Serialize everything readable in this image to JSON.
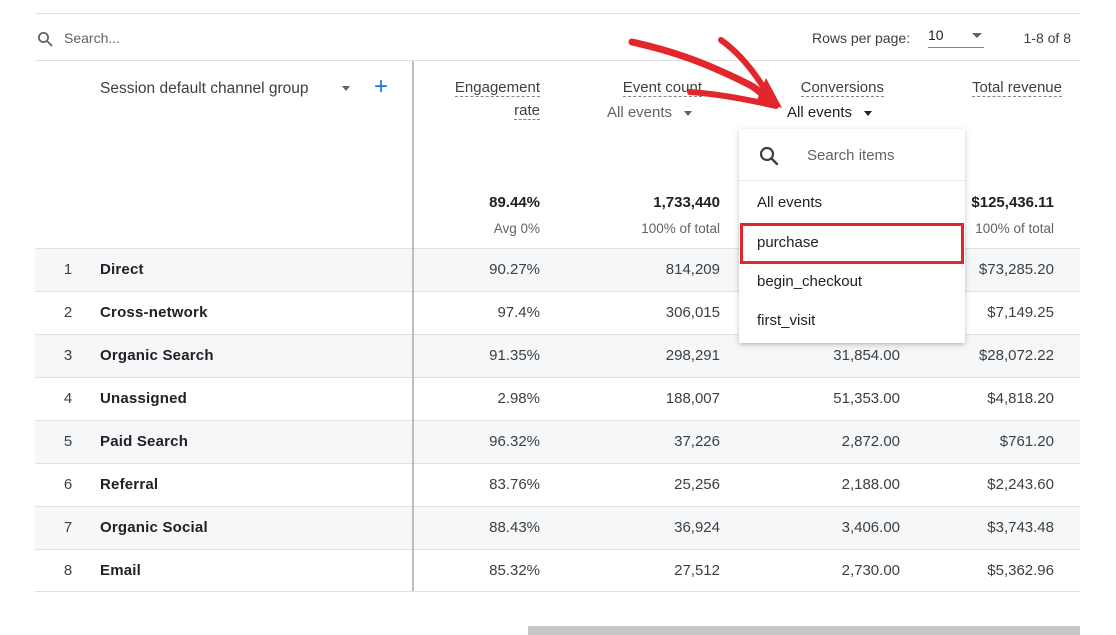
{
  "toolbar": {
    "search_placeholder": "Search...",
    "rows_per_page_label": "Rows per page:",
    "rows_per_page_value": "10",
    "pagination": "1-8 of 8"
  },
  "header": {
    "dimension_label": "Session default channel group",
    "add_symbol": "+",
    "columns": [
      {
        "line1": "Engagement",
        "line2": "rate"
      },
      {
        "line1": "Event count",
        "sub": "All events"
      },
      {
        "line1": "Conversions",
        "sub": "All events"
      },
      {
        "line1": "Total revenue"
      }
    ]
  },
  "totals": {
    "engagement_rate": "89.44%",
    "engagement_sub": "Avg 0%",
    "event_count": "1,733,440",
    "event_sub": "100% of total",
    "revenue": "$125,436.11",
    "revenue_sub": "100% of total"
  },
  "rows": [
    {
      "idx": "1",
      "name": "Direct",
      "engagement": "90.27%",
      "events": "814,209",
      "conversions": "",
      "revenue": "$73,285.20"
    },
    {
      "idx": "2",
      "name": "Cross-network",
      "engagement": "97.4%",
      "events": "306,015",
      "conversions": "",
      "revenue": "$7,149.25"
    },
    {
      "idx": "3",
      "name": "Organic Search",
      "engagement": "91.35%",
      "events": "298,291",
      "conversions": "31,854.00",
      "revenue": "$28,072.22"
    },
    {
      "idx": "4",
      "name": "Unassigned",
      "engagement": "2.98%",
      "events": "188,007",
      "conversions": "51,353.00",
      "revenue": "$4,818.20"
    },
    {
      "idx": "5",
      "name": "Paid Search",
      "engagement": "96.32%",
      "events": "37,226",
      "conversions": "2,872.00",
      "revenue": "$761.20"
    },
    {
      "idx": "6",
      "name": "Referral",
      "engagement": "83.76%",
      "events": "25,256",
      "conversions": "2,188.00",
      "revenue": "$2,243.60"
    },
    {
      "idx": "7",
      "name": "Organic Social",
      "engagement": "88.43%",
      "events": "36,924",
      "conversions": "3,406.00",
      "revenue": "$3,743.48"
    },
    {
      "idx": "8",
      "name": "Email",
      "engagement": "85.32%",
      "events": "27,512",
      "conversions": "2,730.00",
      "revenue": "$5,362.96"
    }
  ],
  "dropdown": {
    "search_placeholder": "Search items",
    "items": [
      "All events",
      "purchase",
      "begin_checkout",
      "first_visit"
    ],
    "highlighted": "purchase"
  },
  "colors": {
    "accent_blue": "#1a73e8",
    "annotation_red": "#e3252c"
  },
  "icons": {
    "toolbar_search": "search-icon",
    "dropdown_search": "search-icon",
    "add": "plus-icon"
  }
}
